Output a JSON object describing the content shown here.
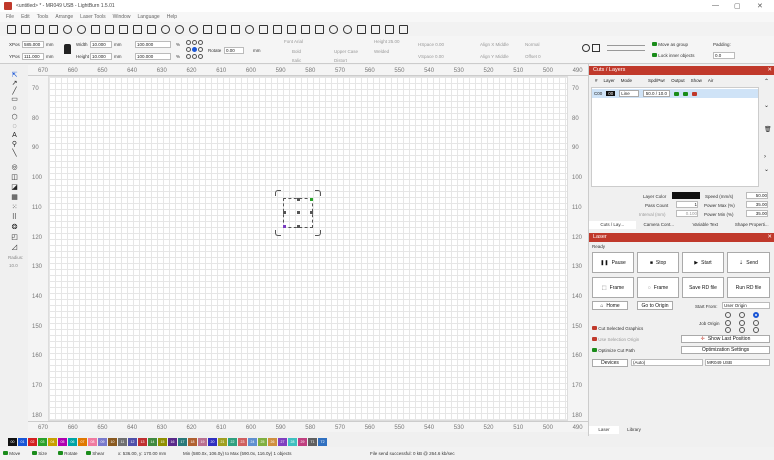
{
  "window": {
    "title": "<untitled> * - MR049 USB - LightBurn 1.5.01",
    "minimize": "—",
    "maximize": "▢",
    "close": "✕"
  },
  "menu": [
    "File",
    "Edit",
    "Tools",
    "Arrange",
    "Laser Tools",
    "Window",
    "Language",
    "Help"
  ],
  "props": {
    "xpos_label": "XPos",
    "xpos": "585.000",
    "ypos_label": "YPos",
    "ypos": "111.000",
    "unit": "mm",
    "width_label": "Width",
    "width": "10.000",
    "height_label": "Height",
    "height": "10.000",
    "scale_w": "100.000",
    "scale_h": "100.000",
    "pct": "%",
    "rotate_label": "Rotate",
    "rotate": "0.00",
    "deg": "mm",
    "font_label": "Font Arial",
    "height2_label": "Height 25.00",
    "hspace": "HSpace 0.00",
    "vspace": "VSpace 0.00",
    "bold": "Bold",
    "italic": "Italic",
    "upper": "Upper Case",
    "distort": "Distort",
    "welded": "Welded",
    "alignx": "Align X Middle",
    "aligny": "Align Y Middle",
    "normal": "Normal",
    "offset": "Offset 0",
    "move_group": "Move as group",
    "lock_objects": "Lock inner objects",
    "padding_label": "Padding:",
    "padding": "0.0"
  },
  "left": {
    "radius_label": "Radius:",
    "radius": "10.0"
  },
  "ruler": {
    "top": [
      "670",
      "660",
      "650",
      "640",
      "630",
      "620",
      "610",
      "600",
      "590",
      "580",
      "570",
      "560",
      "550",
      "540",
      "530",
      "520",
      "510",
      "500",
      "490"
    ],
    "left": [
      "70",
      "80",
      "90",
      "100",
      "110",
      "120",
      "130",
      "140",
      "150",
      "160",
      "170",
      "180"
    ]
  },
  "cuts": {
    "title": "Cuts / Layers",
    "headers": [
      "#",
      "Layer",
      "Mode",
      "Spd/Pwr",
      "Output",
      "Show",
      "Air"
    ],
    "row": {
      "num": "C00",
      "layer": "00",
      "mode": "Line",
      "spdpwr": "50.0 / 10.0"
    },
    "layer_color_label": "Layer Color",
    "speed_label": "Speed (mm/s)",
    "speed": "50.00",
    "pass_label": "Pass Count",
    "pass": "1",
    "pmax_label": "Power Max (%)",
    "pmax": "35.00",
    "interval_label": "Interval (mm)",
    "interval": "0.100",
    "pmin_label": "Power Min (%)",
    "pmin": "35.00",
    "tabs": [
      "Cuts / Lay...",
      "Camera Cont...",
      "Variable Text",
      "Shape Properti..."
    ]
  },
  "laser": {
    "title": "Laser",
    "status": "Ready",
    "pause": "Pause",
    "stop": "Stop",
    "start": "Start",
    "send": "Send",
    "frame1": "Frame",
    "frame2": "Frame",
    "save_rd": "Save RD file",
    "run_rd": "Run RD file",
    "home": "Home",
    "goto_origin": "Go to Origin",
    "start_from_label": "Start From:",
    "start_from": "User Origin",
    "job_origin": "Job Origin",
    "cut_selected": "Cut Selected Graphics",
    "use_origin": "Use Selection Origin",
    "show_last": "Show Last Position",
    "optimize": "Optimize Cut Path",
    "opt_settings": "Optimization Settings",
    "devices": "Devices",
    "auto": "(Auto)",
    "device": "MR049 USB",
    "tabs": [
      "Laser",
      "Library"
    ]
  },
  "palette": [
    "00",
    "01",
    "02",
    "03",
    "04",
    "05",
    "06",
    "07",
    "08",
    "09",
    "10",
    "11",
    "12",
    "13",
    "14",
    "15",
    "16",
    "17",
    "18",
    "19",
    "20",
    "21",
    "22",
    "23",
    "24",
    "25",
    "26",
    "27",
    "28",
    "29",
    "T1",
    "T2"
  ],
  "palette_colors": [
    "#111",
    "#1a56d6",
    "#d42020",
    "#2aa22a",
    "#c8a000",
    "#b000b0",
    "#00a5a5",
    "#e07800",
    "#f07aa0",
    "#7a7acc",
    "#8a5a20",
    "#707070",
    "#5050aa",
    "#c03030",
    "#408a40",
    "#909000",
    "#5a2a8a",
    "#2a7a7a",
    "#b06030",
    "#ba7090",
    "#3030c0",
    "#a0a020",
    "#30a080",
    "#d06060",
    "#6090d0",
    "#80b040",
    "#d09040",
    "#8040c0",
    "#40c0c0",
    "#c04080",
    "#606060",
    "#3070c0"
  ],
  "status": {
    "move": "Move",
    "size": "Size",
    "rotate": "Rotate",
    "shear": "Shear",
    "coords": "x: 536.00, y: 170.00 mm",
    "bounds": "Min (580.0x, 106.0y) to Max (590.0x, 116.0y)  1 objects",
    "send": "File send successful: 0 kB @ 264.6 kb/sec"
  }
}
